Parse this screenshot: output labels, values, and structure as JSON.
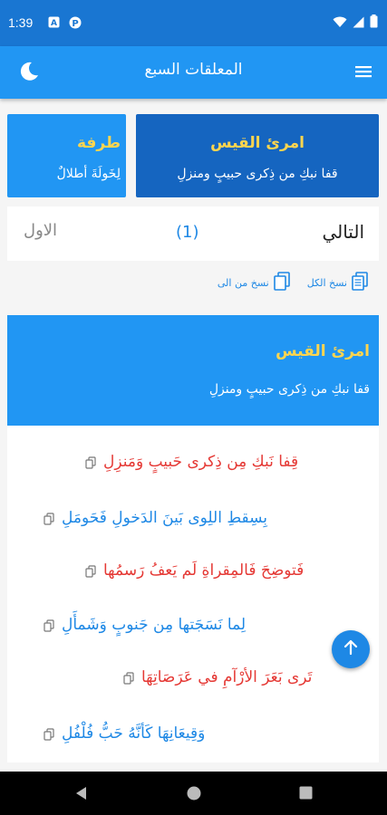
{
  "status": {
    "time": "1:39"
  },
  "app": {
    "title": "المعلقات السبع"
  },
  "cards": [
    {
      "poet": "امرئ القيس",
      "verse": "قفا نبكِ من ذِكرى حبيبٍ ومنزلِ"
    },
    {
      "poet": "طرفة",
      "verse": "لِخَولَةَ أطلالٌ"
    }
  ],
  "nav": {
    "next": "التالي",
    "number": "(1)",
    "first": "الاول"
  },
  "copy": {
    "copy_all": "نسخ الكل",
    "copy_from_to": "نسخ من الى"
  },
  "poem": {
    "poet": "امرئ القيس",
    "title_verse": "قفا نبكِ من ذِكرى حبيبٍ ومنزلِ",
    "verses": [
      {
        "text": "قِفا نَبكِ مِن ذِكرى حَبيبٍ وَمَنزِلِ",
        "color": "red"
      },
      {
        "text": "بِسِقطِ اللِوى بَينَ الدَخولِ فَحَومَلِ",
        "color": "blue"
      },
      {
        "text": "فَتوضِحَ فَالمِقراةِ لَم يَعفُ رَسمُها",
        "color": "red"
      },
      {
        "text": "لِما نَسَجَتها مِن جَنوبٍ وَشَمأَلِ",
        "color": "blue"
      },
      {
        "text": "تَرى بَعَرَ الأرْآمِ في عَرَصَاتِهَا",
        "color": "red"
      },
      {
        "text": "وَقِيعَانِهَا كَأنَّهُ حَبُّ فُلْفُلِ",
        "color": "blue"
      }
    ]
  },
  "colors": {
    "primary": "#2196f3",
    "primary_dark": "#1565c0",
    "accent_text": "#ffd54f",
    "verse_red": "#e53935",
    "verse_blue": "#1e88e5"
  }
}
